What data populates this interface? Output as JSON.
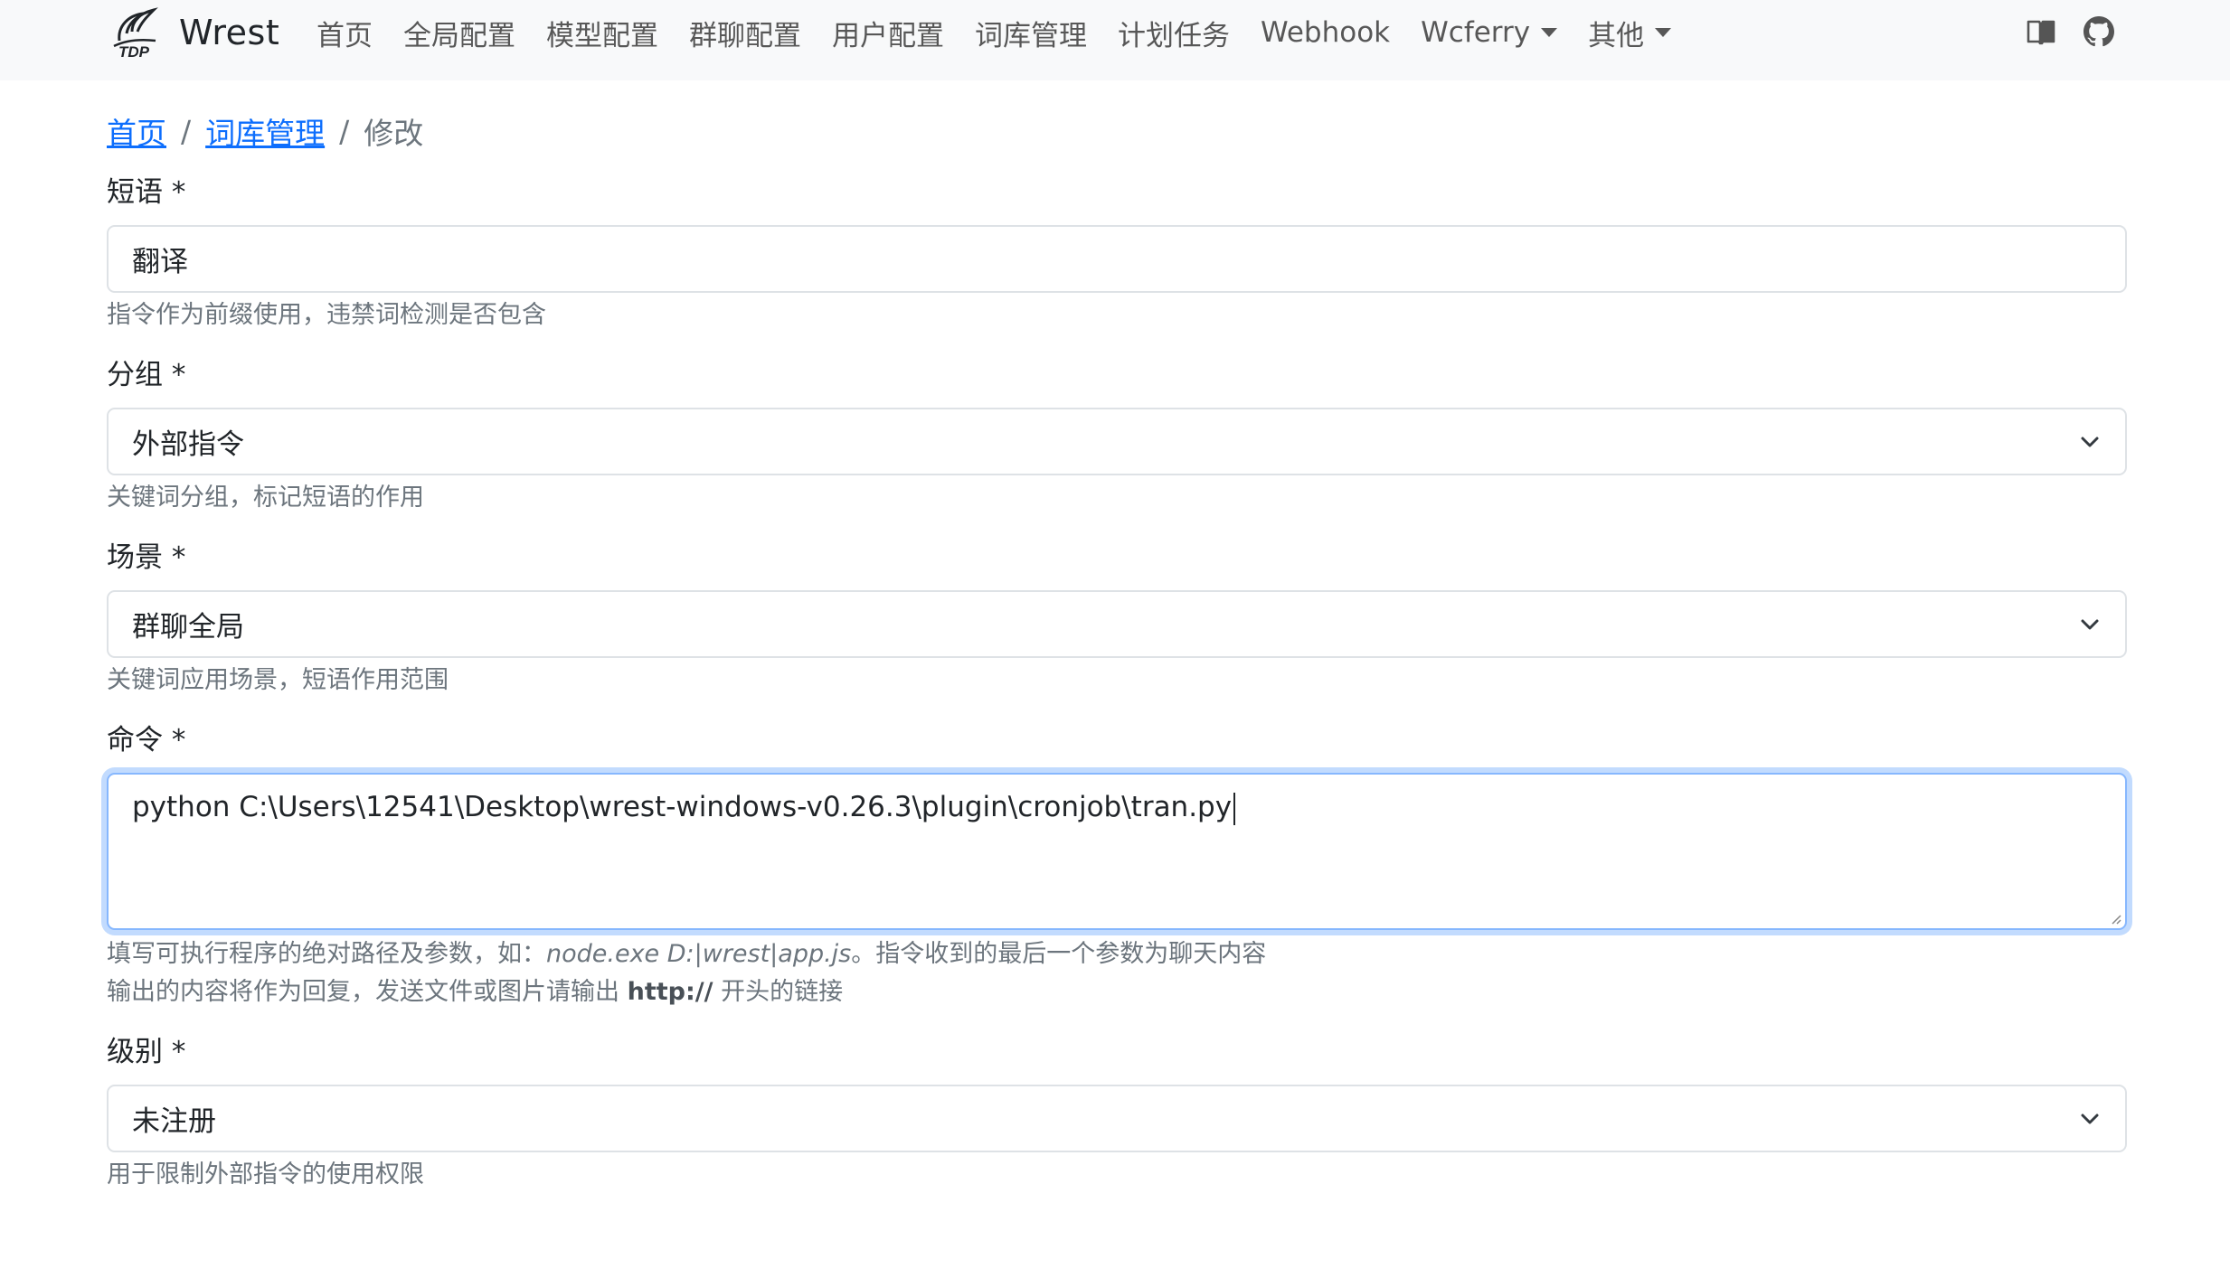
{
  "brand": {
    "logo_text": "TDP",
    "name": "Wrest"
  },
  "nav": {
    "items": [
      {
        "label": "首页",
        "dropdown": false
      },
      {
        "label": "全局配置",
        "dropdown": false
      },
      {
        "label": "模型配置",
        "dropdown": false
      },
      {
        "label": "群聊配置",
        "dropdown": false
      },
      {
        "label": "用户配置",
        "dropdown": false
      },
      {
        "label": "词库管理",
        "dropdown": false
      },
      {
        "label": "计划任务",
        "dropdown": false
      },
      {
        "label": "Webhook",
        "dropdown": false
      },
      {
        "label": "Wcferry",
        "dropdown": true
      },
      {
        "label": "其他",
        "dropdown": true
      }
    ],
    "right_icons": [
      "book-icon",
      "github-icon"
    ]
  },
  "breadcrumb": {
    "items": [
      "首页",
      "词库管理"
    ],
    "separator": "/",
    "current": "修改"
  },
  "form": {
    "phrase": {
      "label": "短语 *",
      "value": "翻译",
      "help": "指令作为前缀使用，违禁词检测是否包含"
    },
    "group": {
      "label": "分组 *",
      "value": "外部指令",
      "help": "关键词分组，标记短语的作用"
    },
    "scene": {
      "label": "场景 *",
      "value": "群聊全局",
      "help": "关键词应用场景，短语作用范围"
    },
    "command": {
      "label": "命令 *",
      "value": "python C:\\Users\\12541\\Desktop\\wrest-windows-v0.26.3\\plugin\\cronjob\\tran.py",
      "help_line1_prefix": "填写可执行程序的绝对路径及参数，如：",
      "help_line1_example": "node.exe D:|wrest|app.js",
      "help_line1_suffix": "。指令收到的最后一个参数为聊天内容",
      "help_line2_prefix": "输出的内容将作为回复，发送文件或图片请输出 ",
      "help_line2_bold": "http://",
      "help_line2_suffix": " 开头的链接"
    },
    "level": {
      "label": "级别 *",
      "value": "未注册",
      "help": "用于限制外部指令的使用权限"
    }
  },
  "colors": {
    "navbar_bg": "#f8f9fa",
    "link": "#0d6efd",
    "muted": "#6c757d",
    "focus_border": "#86b7fe"
  }
}
